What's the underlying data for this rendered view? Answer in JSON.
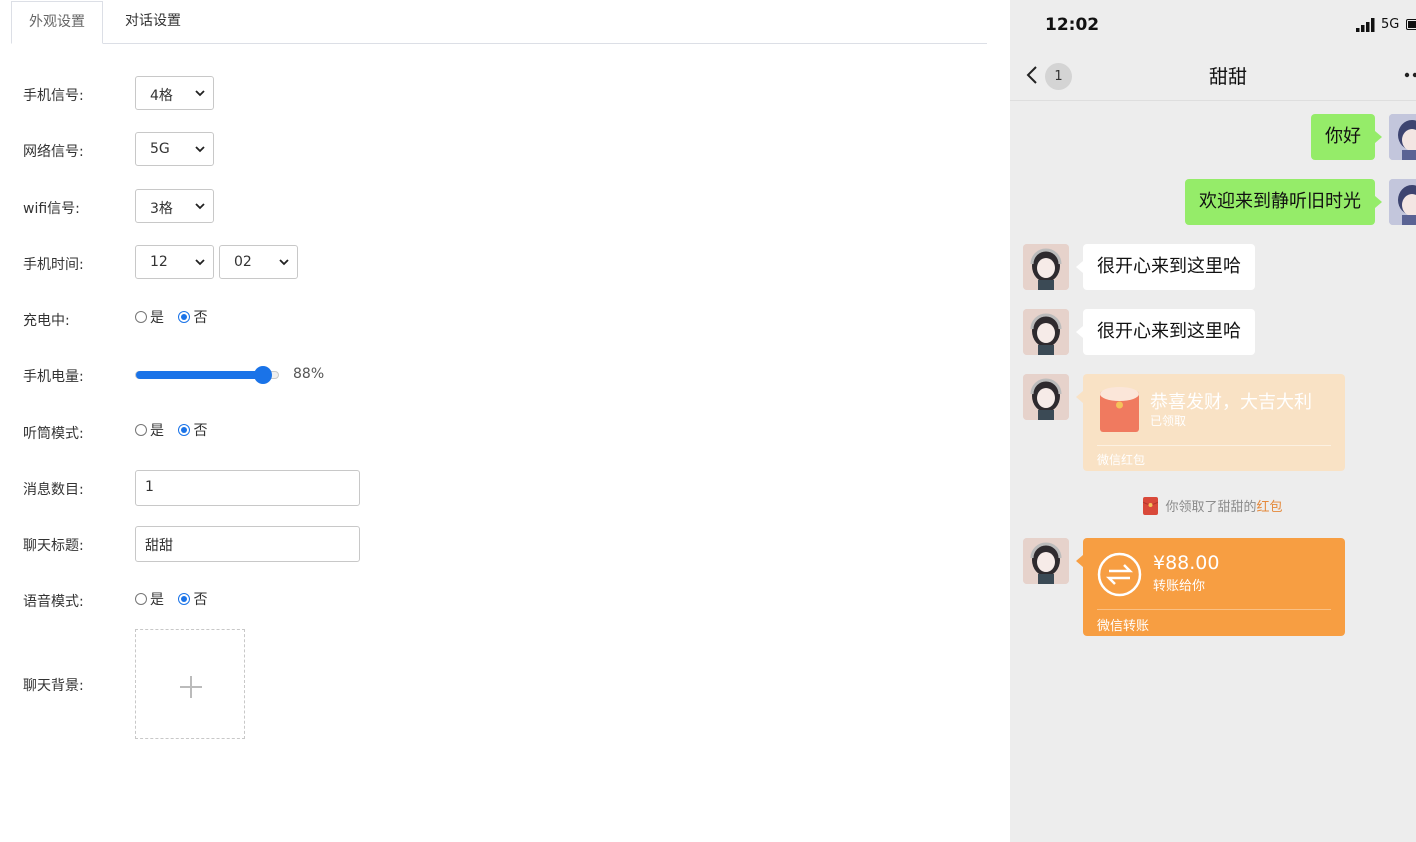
{
  "tabs": [
    {
      "label": "外观设置",
      "active": true
    },
    {
      "label": "对话设置",
      "active": false
    }
  ],
  "form": {
    "signal": {
      "label": "手机信号:",
      "value": "4格"
    },
    "network": {
      "label": "网络信号:",
      "value": "5G"
    },
    "wifi": {
      "label": "wifi信号:",
      "value": "3格"
    },
    "time": {
      "label": "手机时间:",
      "hour": "12",
      "minute": "02"
    },
    "charging": {
      "label": "充电中:",
      "yes": "是",
      "no": "否",
      "selected": "否"
    },
    "battery": {
      "label": "手机电量:",
      "value": 88,
      "value_text": "88%"
    },
    "earpiece": {
      "label": "听筒模式:",
      "yes": "是",
      "no": "否",
      "selected": "否"
    },
    "message_count": {
      "label": "消息数目:",
      "value": "1"
    },
    "chat_title": {
      "label": "聊天标题:",
      "value": "甜甜"
    },
    "voice_mode": {
      "label": "语音模式:",
      "yes": "是",
      "no": "否",
      "selected": "否"
    },
    "chat_background": {
      "label": "聊天背景:"
    }
  },
  "phone": {
    "status": {
      "time": "12:02",
      "network": "5G"
    },
    "nav": {
      "badge": "1",
      "title": "甜甜"
    },
    "messages": [
      {
        "side": "self",
        "text": "你好"
      },
      {
        "side": "self",
        "text": "欢迎来到静听旧时光"
      },
      {
        "side": "other",
        "text": "很开心来到这里哈"
      },
      {
        "side": "other",
        "text": "很开心来到这里哈"
      }
    ],
    "red_packet": {
      "title": "恭喜发财，大吉大利",
      "status": "已领取",
      "footer": "微信红包"
    },
    "system_note": {
      "prefix": "你领取了甜甜的",
      "highlight": "红包"
    },
    "transfer": {
      "amount": "¥88.00",
      "desc": "转账给你",
      "footer": "微信转账"
    },
    "colors": {
      "self_bubble": "#95ec69",
      "red_packet": "#f9e2c5",
      "transfer": "#f79e42",
      "accent": "#1a73e8"
    }
  }
}
